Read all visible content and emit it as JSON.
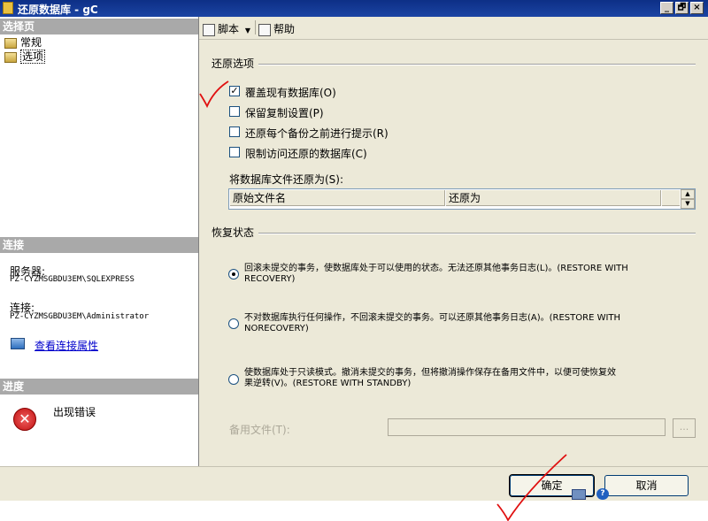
{
  "window": {
    "title": "还原数据库 - gC",
    "controls": [
      "_",
      "🗗",
      "×"
    ]
  },
  "left": {
    "select_page_header": "选择页",
    "nav_items": [
      {
        "label": "常规",
        "icon": "page-icon"
      },
      {
        "label": "选项",
        "icon": "page-icon"
      }
    ],
    "connection_header": "连接",
    "server_label": "服务器:",
    "server_value": "PZ-CYZMSGBDU3EM\\SQLEXPRESS",
    "connection_label": "连接:",
    "connection_value": "PZ-CYZMSGBDU3EM\\Administrator",
    "view_props_link": "查看连接属性",
    "progress_header": "进度",
    "progress_status": "出现错误"
  },
  "toolbar": {
    "script_label": "脚本",
    "help_label": "帮助"
  },
  "restore_options": {
    "group_title": "还原选项",
    "checkboxes": [
      {
        "label": "覆盖现有数据库(O)",
        "checked": true
      },
      {
        "label": "保留复制设置(P)",
        "checked": false
      },
      {
        "label": "还原每个备份之前进行提示(R)",
        "checked": false
      },
      {
        "label": "限制访问还原的数据库(C)",
        "checked": false
      }
    ],
    "files_label": "将数据库文件还原为(S):",
    "grid_columns": [
      "原始文件名",
      "还原为"
    ]
  },
  "recovery_state": {
    "group_title": "恢复状态",
    "options": [
      {
        "line1": "回滚未提交的事务，使数据库处于可以使用的状态。无法还原其他事务日志(L)。(RESTORE WITH",
        "line2": "RECOVERY)",
        "selected": true
      },
      {
        "line1": "不对数据库执行任何操作，不回滚未提交的事务。可以还原其他事务日志(A)。(RESTORE WITH",
        "line2": "NORECOVERY)",
        "selected": false
      },
      {
        "line1": "使数据库处于只读模式。撤消未提交的事务，但将撤消操作保存在备用文件中，以便可使恢复效",
        "line2": "果逆转(V)。(RESTORE WITH STANDBY)",
        "selected": false
      }
    ],
    "standby_label": "备用文件(T):",
    "standby_value": "",
    "browse_label": "..."
  },
  "buttons": {
    "ok": "确定",
    "cancel": "取消"
  },
  "colors": {
    "title_bar": "#0d2f86",
    "panel": "#ece9d8",
    "section_header": "#a9a9a9",
    "annotation": "#e01010"
  }
}
